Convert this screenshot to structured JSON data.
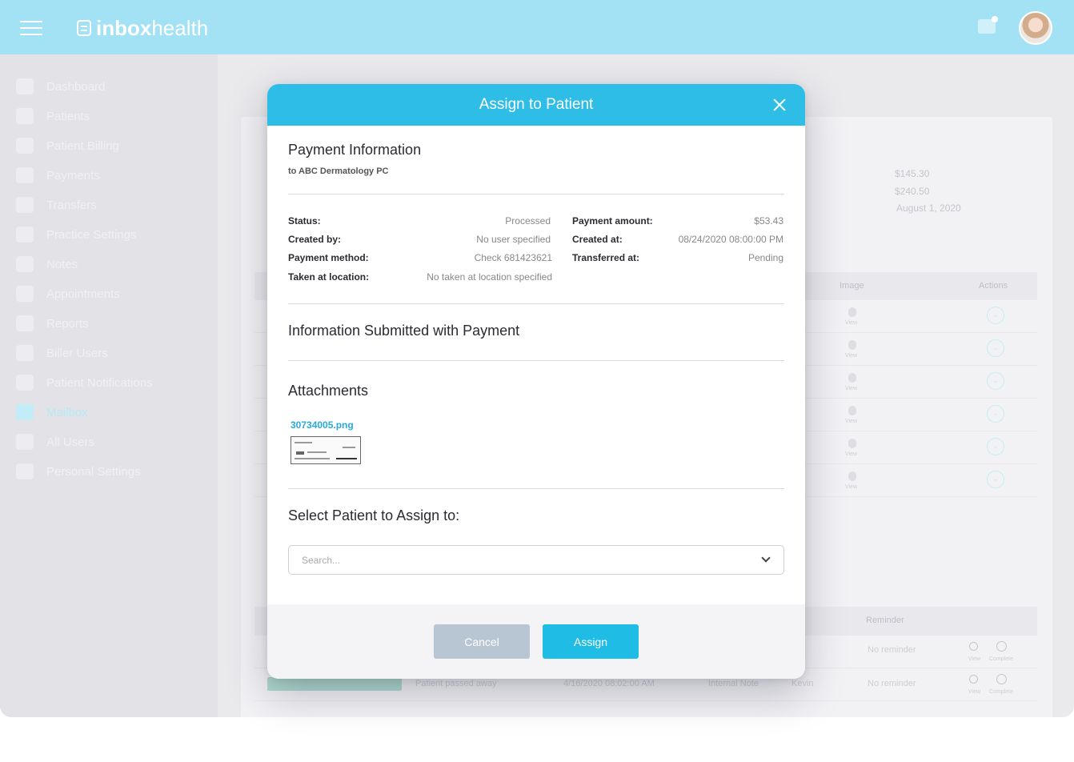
{
  "header": {
    "logo_bold": "inbox",
    "logo_light": "health"
  },
  "sidebar": {
    "items": [
      {
        "label": "Dashboard"
      },
      {
        "label": "Patients"
      },
      {
        "label": "Patient Billing"
      },
      {
        "label": "Payments"
      },
      {
        "label": "Transfers"
      },
      {
        "label": "Practice Settings"
      },
      {
        "label": "Notes"
      },
      {
        "label": "Appointments"
      },
      {
        "label": "Reports"
      },
      {
        "label": "Biller Users"
      },
      {
        "label": "Patient Notifications"
      },
      {
        "label": "Mailbox",
        "active": true
      },
      {
        "label": "All Users"
      },
      {
        "label": "Personal Settings"
      }
    ]
  },
  "background": {
    "summary_values": [
      "$145.30",
      "$240.50",
      "August 1, 2020"
    ],
    "table1_headers": [
      "Image",
      "Actions"
    ],
    "view_label": "View",
    "table2_headers": [
      "Reminder"
    ],
    "table2_rows": [
      {
        "assigned": "",
        "reminder": "No reminder"
      },
      {
        "description": "Patient passed away",
        "date": "4/16/2020 08:02:00 AM",
        "type": "Internal Note",
        "assigned": "Kevin",
        "reminder": "No reminder"
      }
    ],
    "row_action_labels": [
      "View",
      "Complete"
    ]
  },
  "modal": {
    "title": "Assign to Patient",
    "payment_info_title": "Payment Information",
    "payment_to": "to ABC Dermatology PC",
    "fields_left": [
      {
        "label": "Status:",
        "value": "Processed"
      },
      {
        "label": "Created by:",
        "value": "No user specified"
      },
      {
        "label": "Payment method:",
        "value": "Check 681423621"
      },
      {
        "label": "Taken at location:",
        "value": "No taken at location specified"
      }
    ],
    "fields_right": [
      {
        "label": "Payment amount:",
        "value": "$53.43"
      },
      {
        "label": "Created at:",
        "value": "08/24/2020 08:00:00 PM"
      },
      {
        "label": "Transferred at:",
        "value": "Pending"
      }
    ],
    "info_submitted_title": "Information Submitted with Payment",
    "attachments_title": "Attachments",
    "attachment_filename": "30734005.png",
    "select_patient_title": "Select Patient to Assign to:",
    "search_placeholder": "Search...",
    "cancel_label": "Cancel",
    "assign_label": "Assign"
  },
  "colors": {
    "header_bg": "#8fdcf2",
    "modal_header": "#2dbde6",
    "assign_button": "#1fbde6",
    "cancel_button": "#b8c6d4",
    "link": "#28a9d9"
  }
}
